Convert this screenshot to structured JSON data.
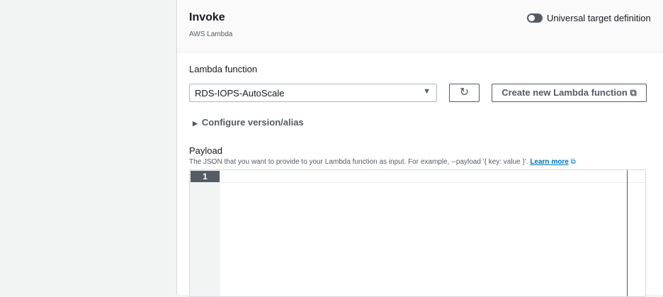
{
  "header": {
    "title": "Invoke",
    "subtitle": "AWS Lambda",
    "toggle_label": "Universal target definition"
  },
  "lambda": {
    "label": "Lambda function",
    "selected": "RDS-IOPS-AutoScale",
    "create_label": "Create new Lambda function",
    "configure_label": "Configure version/alias"
  },
  "payload": {
    "label": "Payload",
    "description": "The JSON that you want to provide to your Lambda function as input. For example, --payload '{ key: value }'.",
    "learn_more": "Learn more",
    "line_number": "1"
  }
}
